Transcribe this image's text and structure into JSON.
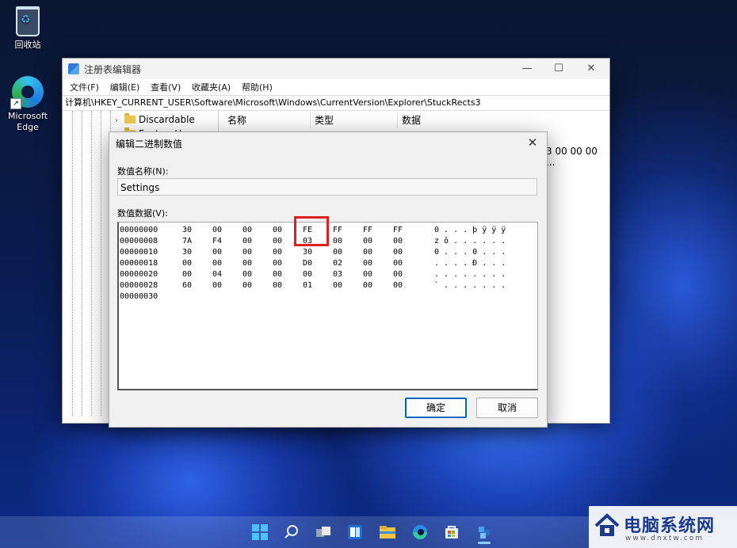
{
  "desktop": {
    "icons": [
      {
        "label": "回收站"
      },
      {
        "label": "Microsoft Edge"
      }
    ]
  },
  "regedit": {
    "title": "注册表编辑器",
    "window_controls": {
      "minimize": "—",
      "maximize": "☐",
      "close": "✕"
    },
    "menu": [
      "文件(F)",
      "编辑(E)",
      "查看(V)",
      "收藏夹(A)",
      "帮助(H)"
    ],
    "address": "计算机\\HKEY_CURRENT_USER\\Software\\Microsoft\\Windows\\CurrentVersion\\Explorer\\StuckRects3",
    "tree": [
      {
        "label": "Discardable",
        "chevron": "›"
      },
      {
        "label": "FeatureUs",
        "chevron": "›"
      }
    ],
    "columns": [
      "名称",
      "类型",
      "数据"
    ],
    "data_peek": "3 00 00 00 ..."
  },
  "dialog": {
    "title": "编辑二进制数值",
    "close": "✕",
    "value_name_label": "数值名称(N):",
    "value_name": "Settings",
    "value_data_label": "数值数据(V):",
    "rows": [
      {
        "offset": "00000000",
        "bytes": [
          "30",
          "00",
          "00",
          "00",
          "FE",
          "FF",
          "FF",
          "FF"
        ],
        "ascii": "0 . . . þ ÿ ÿ ÿ"
      },
      {
        "offset": "00000008",
        "bytes": [
          "7A",
          "F4",
          "00",
          "00",
          "03",
          "00",
          "00",
          "00"
        ],
        "ascii": "z ô . . . . . ."
      },
      {
        "offset": "00000010",
        "bytes": [
          "30",
          "00",
          "00",
          "00",
          "30",
          "00",
          "00",
          "00"
        ],
        "ascii": "0 . . . 0 . . ."
      },
      {
        "offset": "00000018",
        "bytes": [
          "00",
          "00",
          "00",
          "00",
          "D0",
          "02",
          "00",
          "00"
        ],
        "ascii": ". . . . Ð . . ."
      },
      {
        "offset": "00000020",
        "bytes": [
          "00",
          "04",
          "00",
          "00",
          "00",
          "03",
          "00",
          "00"
        ],
        "ascii": ". . . . . . . ."
      },
      {
        "offset": "00000028",
        "bytes": [
          "60",
          "00",
          "00",
          "00",
          "01",
          "00",
          "00",
          "00"
        ],
        "ascii": "` . . . . . . ."
      },
      {
        "offset": "00000030",
        "bytes": [],
        "ascii": ""
      }
    ],
    "highlight_color": "#e02020",
    "ok_label": "确定",
    "cancel_label": "取消"
  },
  "taskbar": {
    "icons": [
      "start-icon",
      "search-icon",
      "task-view-icon",
      "widgets-icon",
      "file-explorer-icon",
      "edge-icon",
      "store-icon",
      "regedit-icon"
    ]
  },
  "watermark": {
    "title": "电脑系统网",
    "url": "www.dnxtw.com"
  }
}
